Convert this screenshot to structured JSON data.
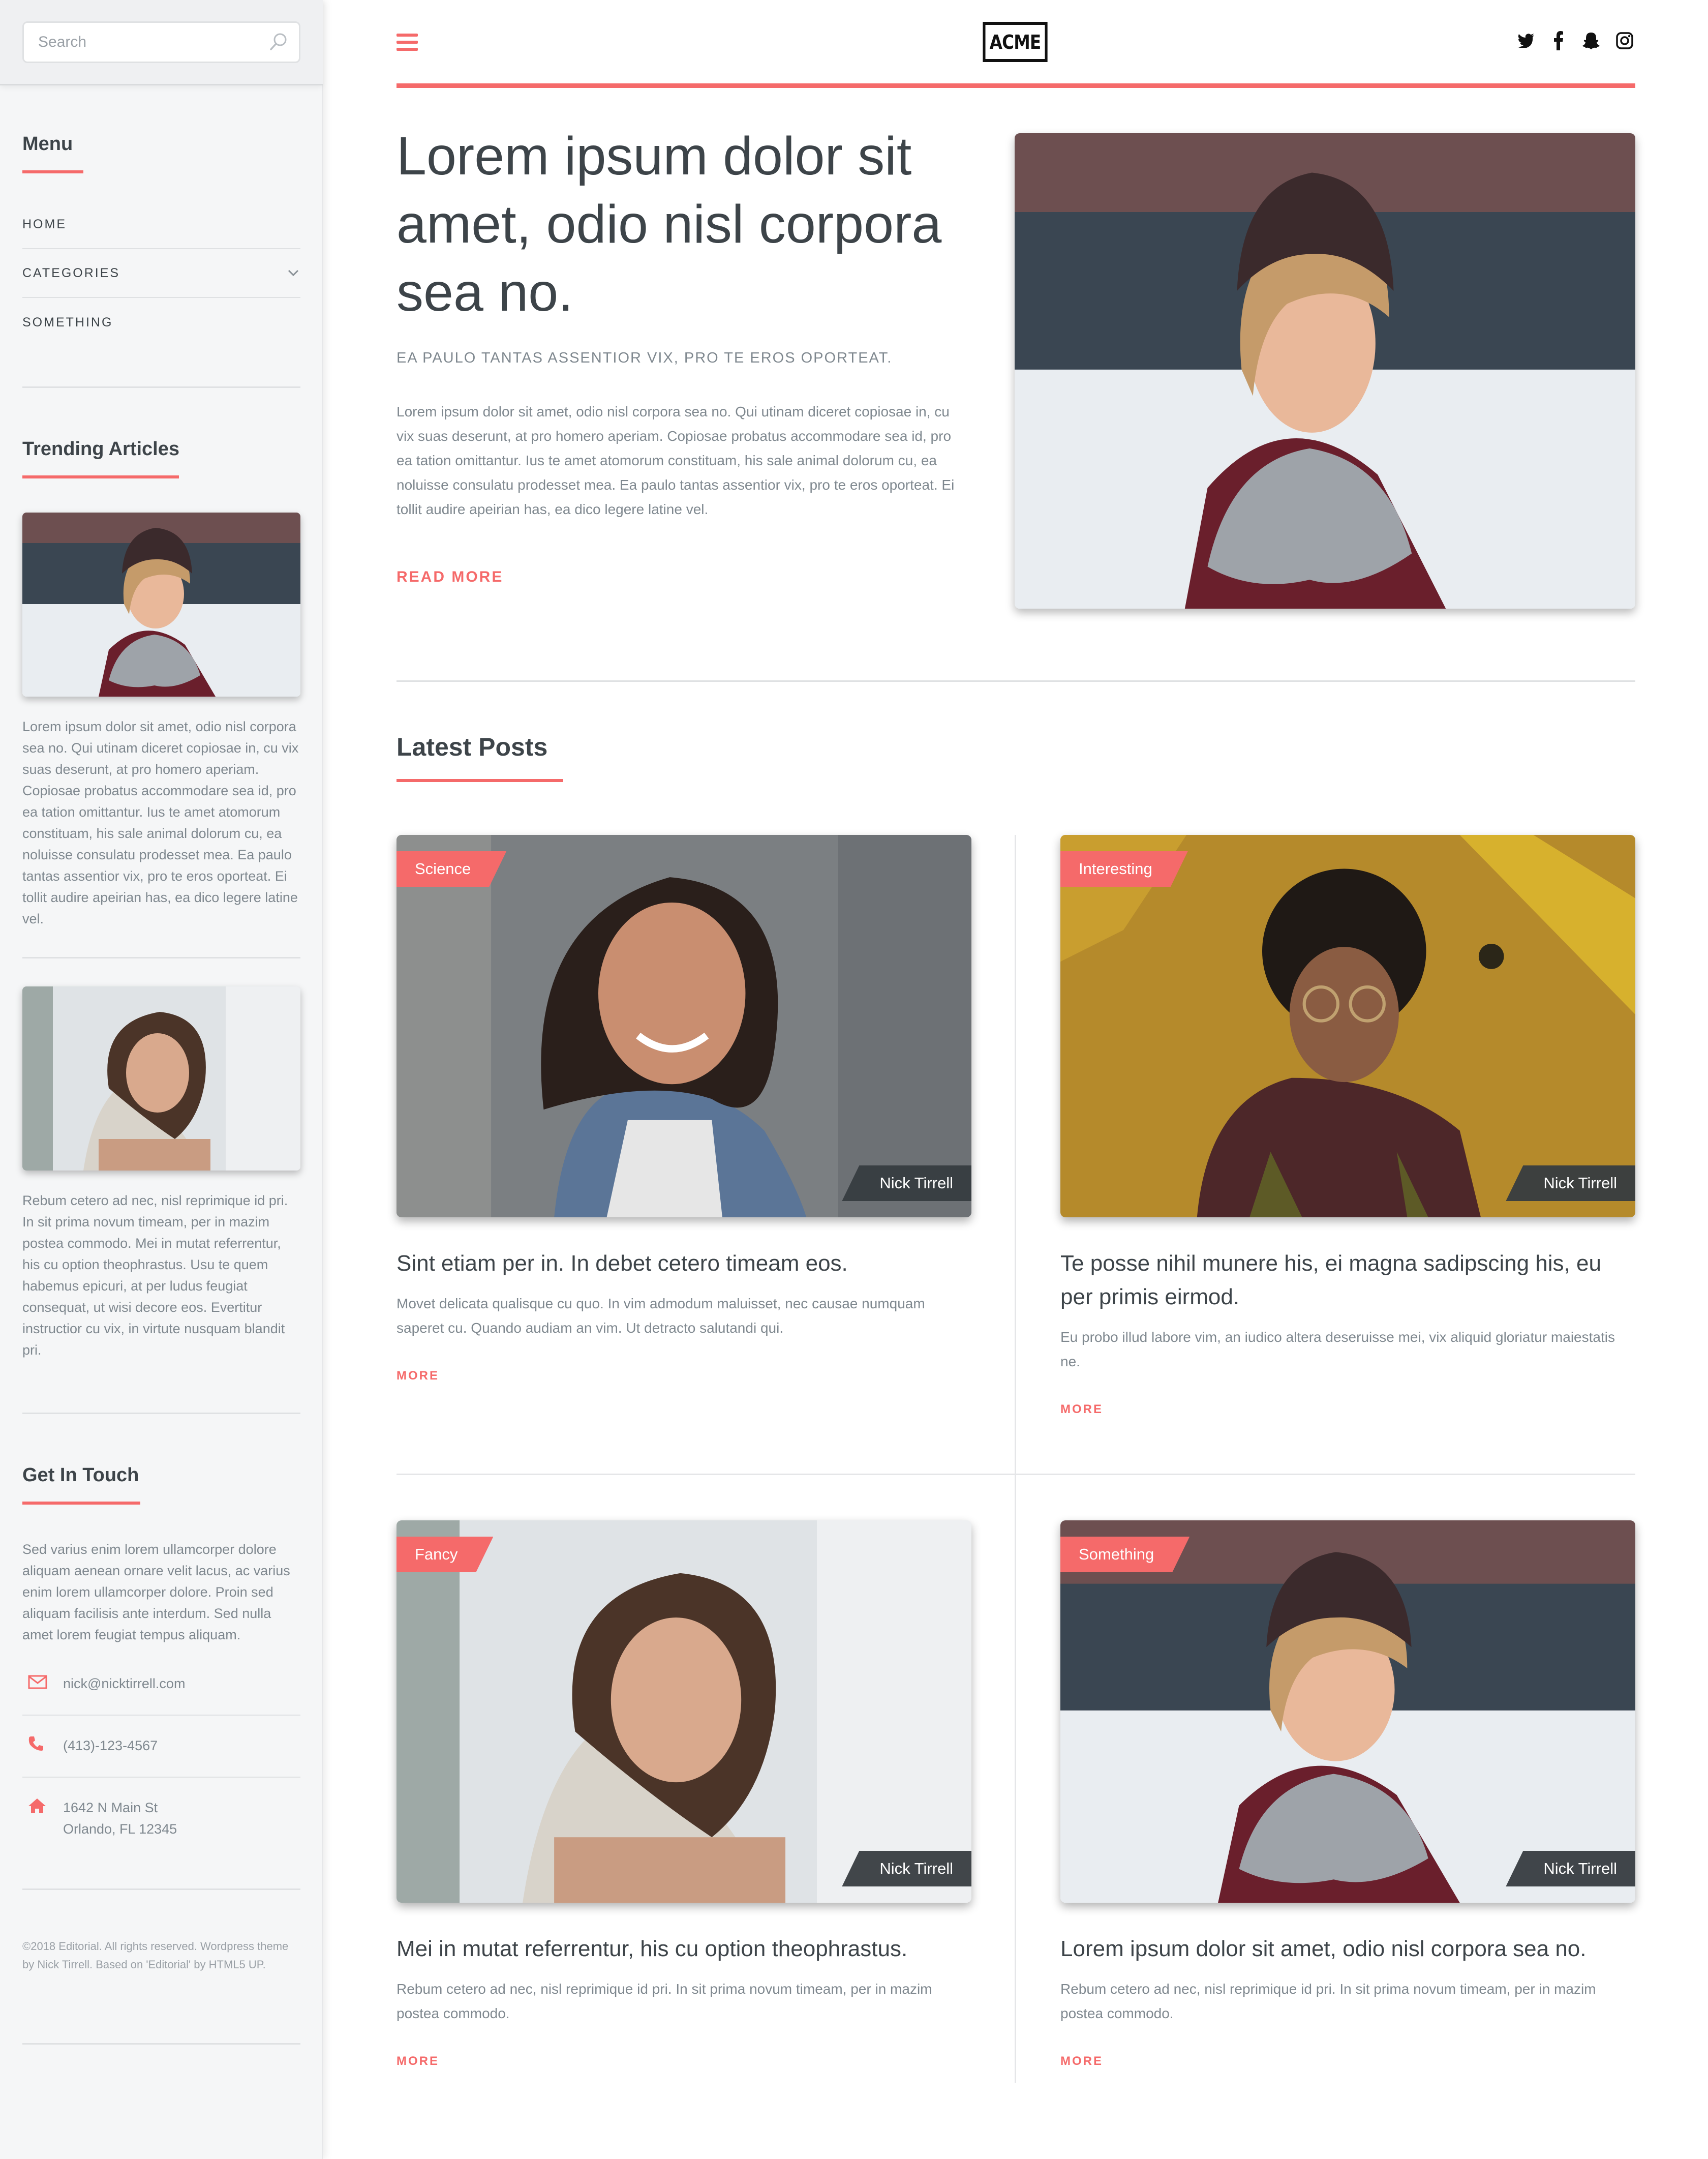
{
  "sidebar": {
    "search_placeholder": "Search",
    "menu": {
      "heading": "Menu",
      "items": [
        {
          "label": "HOME"
        },
        {
          "label": "CATEGORIES"
        },
        {
          "label": "SOMETHING"
        }
      ]
    },
    "trending": {
      "heading": "Trending Articles",
      "articles": [
        {
          "text": "Lorem ipsum dolor sit amet, odio nisl corpora sea no. Qui utinam diceret copiosae in, cu vix suas deserunt, at pro homero aperiam. Copiosae probatus accommodare sea id, pro ea tation omittantur. Ius te amet atomorum constituam, his sale animal dolorum cu, ea noluisse consulatu prodesset mea. Ea paulo tantas assentior vix, pro te eros oporteat. Ei tollit audire apeirian has, ea dico legere latine vel."
        },
        {
          "text": "Rebum cetero ad nec, nisl reprimique id pri. In sit prima novum timeam, per in mazim postea commodo. Mei in mutat referrentur, his cu option theophrastus. Usu te quem habemus epicuri, at per ludus feugiat consequat, ut wisi decore eos. Evertitur instructior cu vix, in virtute nusquam blandit pri."
        }
      ]
    },
    "contact": {
      "heading": "Get In Touch",
      "text": "Sed varius enim lorem ullamcorper dolore aliquam aenean ornare velit lacus, ac varius enim lorem ullamcorper dolore. Proin sed aliquam facilisis ante interdum. Sed nulla amet lorem feugiat tempus aliquam.",
      "email": "nick@nicktirrell.com",
      "phone": "(413)-123-4567",
      "address_line1": "1642 N Main St",
      "address_line2": "Orlando, FL 12345"
    },
    "footer": "©2018 Editorial. All rights reserved. Wordpress theme by Nick Tirrell. Based on 'Editorial' by HTML5 UP."
  },
  "header": {
    "logo": "ACME",
    "social_icons": [
      "twitter-icon",
      "facebook-icon",
      "snapchat-icon",
      "instagram-icon"
    ]
  },
  "hero": {
    "title": "Lorem ipsum dolor sit amet, odio nisl corpora sea no.",
    "subtitle": "EA PAULO TANTAS ASSENTIOR VIX, PRO TE EROS OPORTEAT.",
    "body": "Lorem ipsum dolor sit amet, odio nisl corpora sea no. Qui utinam diceret copiosae in, cu vix suas deserunt, at pro homero aperiam. Copiosae probatus accommodare sea id, pro ea tation omittantur. Ius te amet atomorum constituam, his sale animal dolorum cu, ea noluisse consulatu prodesset mea. Ea paulo tantas assentior vix, pro te eros oporteat. Ei tollit audire apeirian has, ea dico legere latine vel.",
    "read_more": "READ MORE"
  },
  "latest": {
    "heading": "Latest Posts",
    "posts": [
      {
        "tag": "Science",
        "author": "Nick Tirrell",
        "title": "Sint etiam per in. In debet cetero timeam eos.",
        "excerpt": "Movet delicata qualisque cu quo. In vim admodum maluisset, nec causae numquam saperet cu. Quando audiam an vim. Ut detracto salutandi qui.",
        "more": "MORE"
      },
      {
        "tag": "Interesting",
        "author": "Nick Tirrell",
        "title": "Te posse nihil munere his, ei magna sadipscing his, eu per primis eirmod.",
        "excerpt": "Eu probo illud labore vim, an iudico altera deseruisse mei, vix aliquid gloriatur maiestatis ne.",
        "more": "MORE"
      },
      {
        "tag": "Fancy",
        "author": "Nick Tirrell",
        "title": "Mei in mutat referrentur, his cu option theophrastus.",
        "excerpt": "Rebum cetero ad nec, nisl reprimique id pri. In sit prima novum timeam, per in mazim postea commodo.",
        "more": "MORE"
      },
      {
        "tag": "Something",
        "author": "Nick Tirrell",
        "title": "Lorem ipsum dolor sit amet, odio nisl corpora sea no.",
        "excerpt": "Rebum cetero ad nec, nisl reprimique id pri. In sit prima novum timeam, per in mazim postea commodo.",
        "more": "MORE"
      }
    ]
  },
  "colors": {
    "accent": "#f56a6a",
    "text": "#3d4449",
    "muted": "#7f888f",
    "sidebar_bg": "#f5f6f7"
  }
}
